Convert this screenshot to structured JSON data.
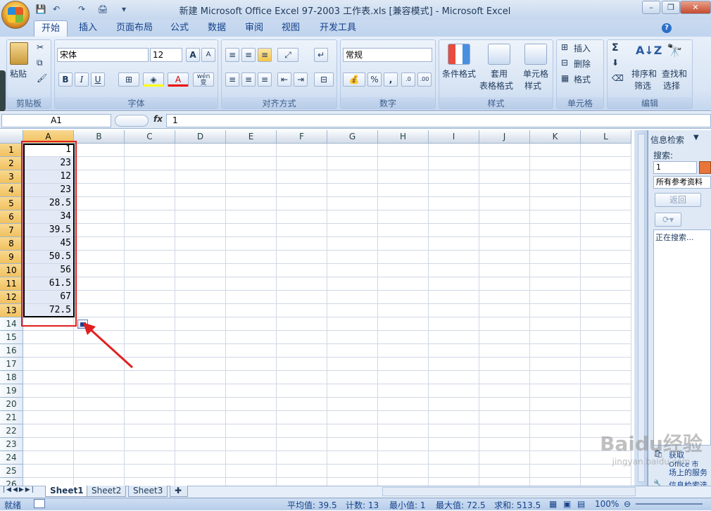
{
  "window": {
    "title": "新建 Microsoft Office Excel 97-2003 工作表.xls  [兼容模式] - Microsoft Excel",
    "minimize": "–",
    "restore": "❐",
    "close": "✕"
  },
  "quick_access": [
    "💾",
    "↶",
    "↷",
    "🖨",
    "▾"
  ],
  "tabs": [
    "开始",
    "插入",
    "页面布局",
    "公式",
    "数据",
    "审阅",
    "视图",
    "开发工具"
  ],
  "ribbon": {
    "clipboard": {
      "label": "剪贴板",
      "paste": "粘贴"
    },
    "font": {
      "label": "字体",
      "name": "宋体",
      "size": "12",
      "bold": "B",
      "italic": "I",
      "underline": "U",
      "grow": "A",
      "shrink": "A",
      "wen": "wén 变"
    },
    "align": {
      "label": "对齐方式"
    },
    "number": {
      "label": "数字",
      "format": "常规",
      "percent": "%",
      "comma": ","
    },
    "styles": {
      "label": "样式",
      "cond": "条件格式",
      "table1": "套用",
      "table2": "表格格式",
      "cell1": "单元格",
      "cell2": "样式"
    },
    "cells": {
      "label": "单元格",
      "insert": "插入",
      "delete": "删除",
      "format": "格式"
    },
    "editing": {
      "label": "编辑",
      "sort1": "排序和",
      "sort2": "筛选",
      "find1": "查找和",
      "find2": "选择"
    }
  },
  "formula_bar": {
    "name_box": "A1",
    "fx": "fx",
    "value": "1"
  },
  "columns": [
    "A",
    "B",
    "C",
    "D",
    "E",
    "F",
    "G",
    "H",
    "I",
    "J",
    "K",
    "L"
  ],
  "rows": [
    "1",
    "2",
    "3",
    "4",
    "5",
    "6",
    "7",
    "8",
    "9",
    "10",
    "11",
    "12",
    "13",
    "14",
    "15",
    "16",
    "17",
    "18",
    "19",
    "20",
    "21",
    "22",
    "23",
    "24",
    "25",
    "26"
  ],
  "column_a_values": [
    "1",
    "23",
    "12",
    "23",
    "28.5",
    "34",
    "39.5",
    "45",
    "50.5",
    "56",
    "61.5",
    "67",
    "72.5"
  ],
  "task_pane": {
    "title": "信息检索",
    "search_label": "搜索:",
    "search_value": "1",
    "source": "所有参考资料",
    "back": "返回",
    "status": "正在搜索...",
    "get1": "获取",
    "get2": "Office 市",
    "get3": "场上的服务",
    "options": "信息检索选"
  },
  "sheets": [
    "Sheet1",
    "Sheet2",
    "Sheet3"
  ],
  "status": {
    "ready": "就绪",
    "average": "平均值: 39.5",
    "count": "计数: 13",
    "min": "最小值: 1",
    "max": "最大值: 72.5",
    "sum": "求和: 513.5",
    "zoom": "100%"
  },
  "watermark": {
    "brand": "Baidu经验",
    "url": "jingyan.baidu.com"
  }
}
